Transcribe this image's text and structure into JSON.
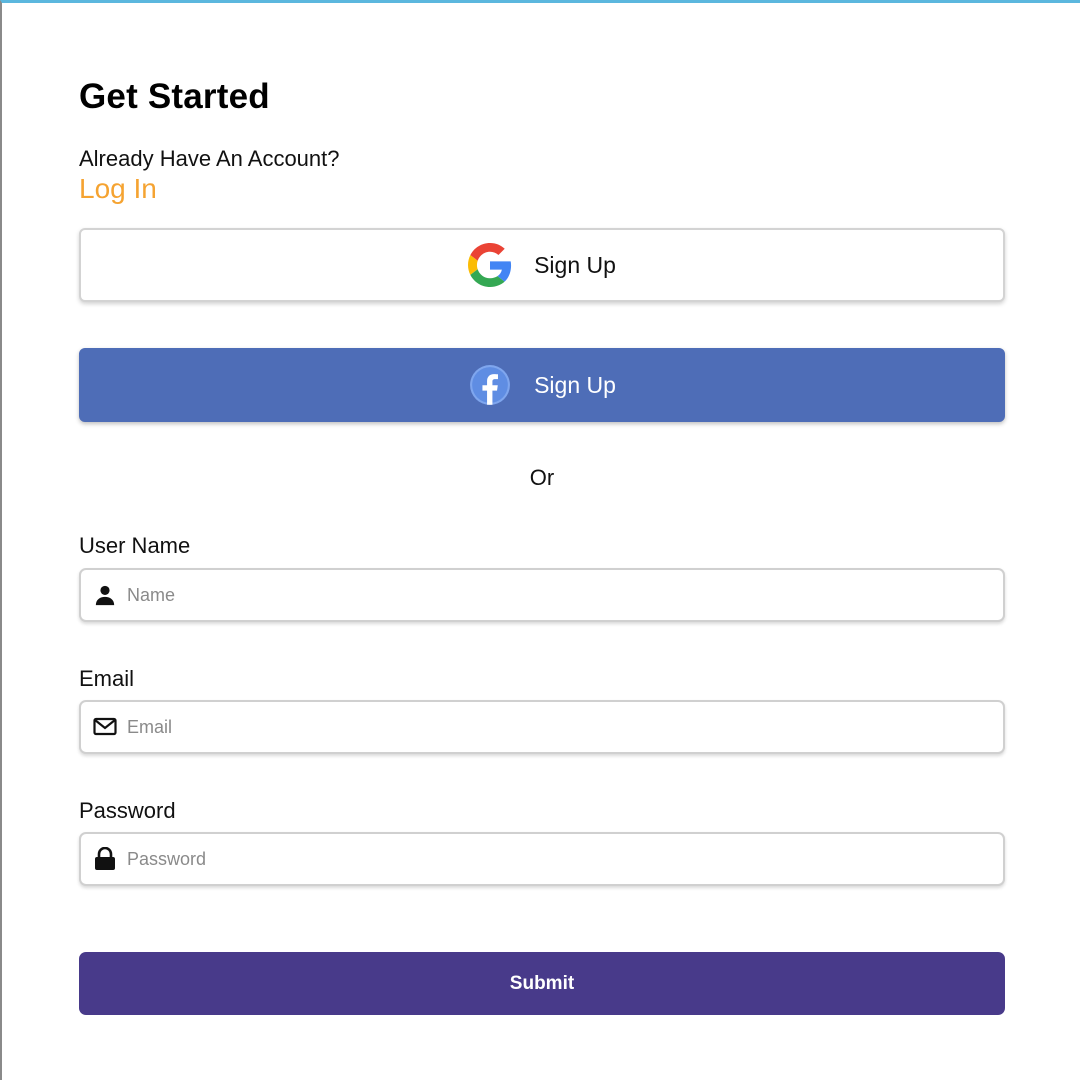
{
  "form": {
    "title": "Get Started",
    "account_prompt": "Already Have An Account?",
    "login_label": "Log In",
    "google_button": {
      "label": "Sign Up",
      "icon": "google-icon"
    },
    "facebook_button": {
      "label": "Sign Up",
      "icon": "facebook-icon"
    },
    "divider": "Or",
    "fields": {
      "username": {
        "label": "User Name",
        "placeholder": "Name",
        "value": "",
        "icon": "user-icon"
      },
      "email": {
        "label": "Email",
        "placeholder": "Email",
        "value": "",
        "icon": "envelope-icon"
      },
      "password": {
        "label": "Password",
        "placeholder": "Password",
        "value": "",
        "icon": "lock-icon"
      }
    },
    "submit_label": "Submit"
  },
  "colors": {
    "accent": "#f5a331",
    "facebook": "#4e6db7",
    "submit": "#483a8a",
    "top_border": "#5bb7de"
  }
}
